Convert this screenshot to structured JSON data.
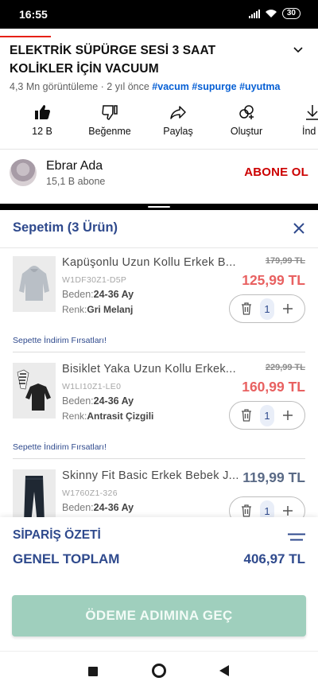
{
  "status": {
    "time": "16:55",
    "battery": "30"
  },
  "youtube": {
    "title": "ELEKTRİK SÜPÜRGE SESİ 3 SAAT KOLİKLER İÇİN VACUUM",
    "views": "4,3 Mn görüntüleme",
    "age": "2 yıl önce",
    "tags": [
      "#vacum",
      "#supurge",
      "#uyutma"
    ],
    "actions": [
      {
        "label": "12 B",
        "icon": "like-icon"
      },
      {
        "label": "Beğenme",
        "icon": "dislike-icon"
      },
      {
        "label": "Paylaş",
        "icon": "share-icon"
      },
      {
        "label": "Oluştur",
        "icon": "create-icon"
      },
      {
        "label": "İnd",
        "icon": "download-icon"
      }
    ],
    "channel": {
      "name": "Ebrar Ada",
      "subscribers": "15,1 B abone"
    },
    "subscribe_label": "ABONE OL"
  },
  "cart": {
    "title": "Sepetim (3 Ürün)",
    "items": [
      {
        "name": "Kapüşonlu Uzun Kollu Erkek B...",
        "sku": "W1DF30Z1-D5P",
        "size_label": "Beden:",
        "size": "24-36 Ay",
        "color_label": "Renk:",
        "color": "Gri Melanj",
        "old_price": "179,99 TL",
        "price": "125,99 TL",
        "qty": "1",
        "discount_link": "Sepette İndirim Fırsatları!"
      },
      {
        "name": "Bisiklet Yaka Uzun Kollu Erkek...",
        "sku": "W1LI10Z1-LE0",
        "size_label": "Beden:",
        "size": "24-36 Ay",
        "color_label": "Renk:",
        "color": "Antrasit Çizgili",
        "old_price": "229,99 TL",
        "price": "160,99 TL",
        "qty": "1",
        "discount_link": "Sepette İndirim Fırsatları!"
      },
      {
        "name": "Skinny Fit Basic Erkek Bebek J...",
        "sku": "W1760Z1-326",
        "size_label": "Beden:",
        "size": "24-36 Ay",
        "price": "119,99 TL",
        "qty": "1"
      }
    ],
    "summary_title": "SİPARİŞ ÖZETİ",
    "total_label": "GENEL TOPLAM",
    "total_value": "406,97 TL",
    "pay_button": "ÖDEME ADIMINA GEÇ"
  }
}
